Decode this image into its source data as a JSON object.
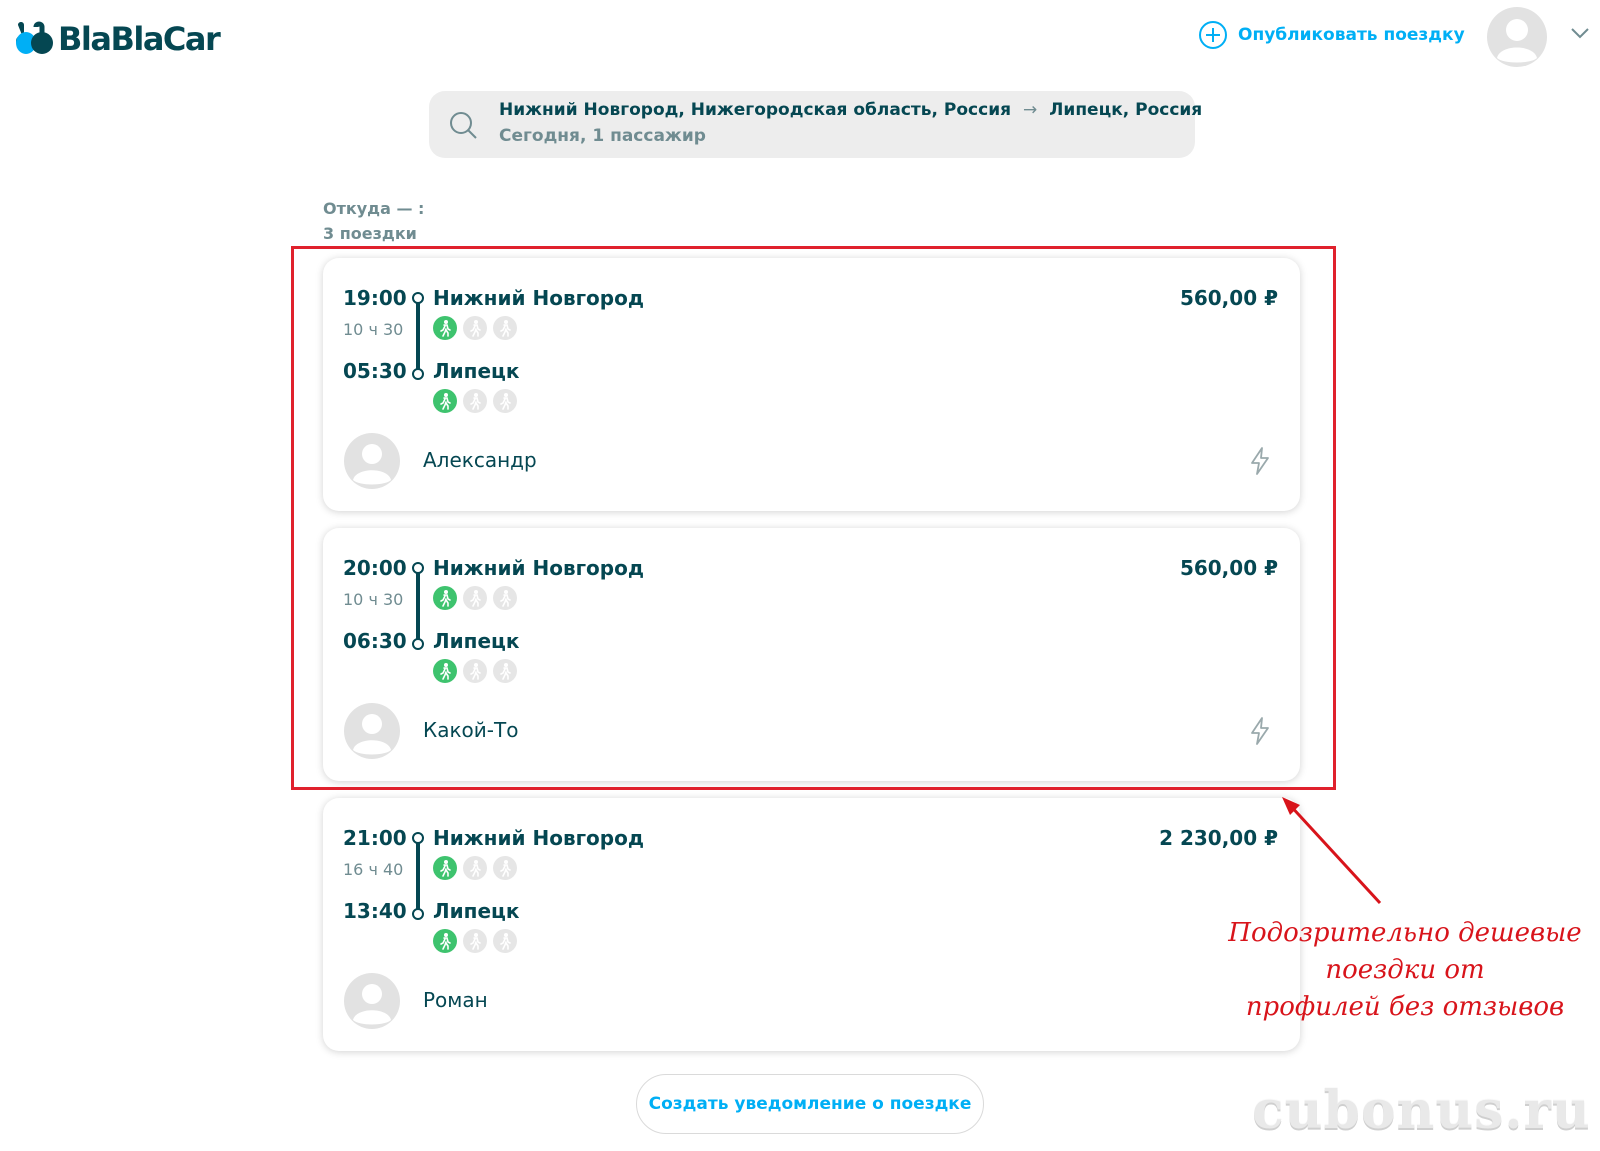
{
  "header": {
    "logo_text": "BlaBlaCar",
    "publish_label": "Опубликовать поездку"
  },
  "search": {
    "from": "Нижний Новгород, Нижегородская область, Россия",
    "to": "Липецк, Россия",
    "subtitle": "Сегодня, 1 пассажир"
  },
  "results": {
    "from_label": "Откуда — :",
    "count_label": "3 поездки"
  },
  "trips": [
    {
      "dep_time": "19:00",
      "duration": "10 ч 30",
      "arr_time": "05:30",
      "dep_city": "Нижний Новгород",
      "arr_city": "Липецк",
      "price": "560,00 ₽",
      "driver": "Александр",
      "instant_booking": true
    },
    {
      "dep_time": "20:00",
      "duration": "10 ч 30",
      "arr_time": "06:30",
      "dep_city": "Нижний Новгород",
      "arr_city": "Липецк",
      "price": "560,00 ₽",
      "driver": "Какой-То",
      "instant_booking": true
    },
    {
      "dep_time": "21:00",
      "duration": "16 ч 40",
      "arr_time": "13:40",
      "dep_city": "Нижний Новгород",
      "arr_city": "Липецк",
      "price": "2 230,00 ₽",
      "driver": "Роман",
      "instant_booking": false
    }
  ],
  "annotation": {
    "line1": "Подозрительно дешевые",
    "line2": "поездки от",
    "line3": "профилей без отзывов"
  },
  "notify_label": "Создать уведомление о поездке",
  "watermark": "cubonus.ru",
  "colors": {
    "brand_dark": "#054752",
    "brand_blue": "#00aff5",
    "walk_green": "#3ec36e",
    "highlight_red": "#e0212d"
  }
}
